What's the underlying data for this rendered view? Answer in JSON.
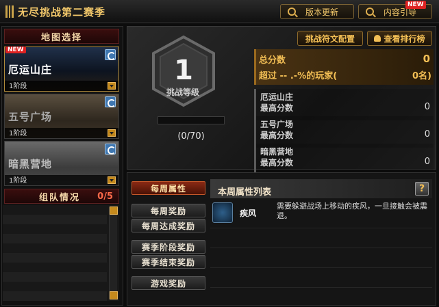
{
  "header": {
    "title": "无尽挑战第二赛季",
    "update_btn": "版本更新",
    "guide_btn": "内容引导",
    "new_badge": "NEW"
  },
  "left": {
    "map_section": "地图选择",
    "maps": [
      {
        "name": "厄运山庄",
        "stage": "1阶段",
        "new": "NEW"
      },
      {
        "name": "五号广场",
        "stage": "1阶段"
      },
      {
        "name": "暗黑营地",
        "stage": "1阶段"
      }
    ],
    "team_section": "组队情况",
    "team_count": "0/5"
  },
  "rank": {
    "level": "1",
    "caption": "挑战等级",
    "progress_text": "(0/70)",
    "progress": 0
  },
  "actions": {
    "config_btn": "挑战符文配置",
    "ranking_btn": "查看排行榜"
  },
  "score": {
    "total_label": "总分数",
    "total_value": "0",
    "exceed_label": "超过 -- .-%的玩家(",
    "exceed_value": "0名)",
    "maps": [
      {
        "name": "厄运山庄",
        "label": "最高分数",
        "value": "0"
      },
      {
        "name": "五号广场",
        "label": "最高分数",
        "value": "0"
      },
      {
        "name": "暗黑营地",
        "label": "最高分数",
        "value": "0"
      }
    ]
  },
  "tabs": [
    "每周属性",
    "每周奖励",
    "每周达成奖励",
    "赛季阶段奖励",
    "赛季结束奖励",
    "游戏奖励"
  ],
  "weekly": {
    "title": "本周属性列表",
    "help": "?",
    "items": [
      {
        "name": "疾风",
        "desc": "需要躲避战场上移动的疾风，一旦接触会被震退。"
      }
    ]
  },
  "colors": {
    "gold": "#f3bf55",
    "accent_red": "#8a2a14",
    "badge": "#dd2222"
  }
}
